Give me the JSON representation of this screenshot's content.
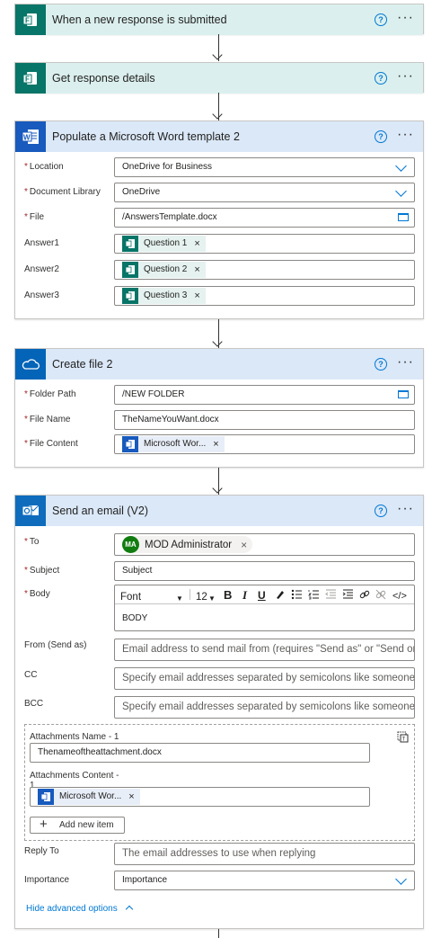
{
  "steps": {
    "trigger": {
      "title": "When a new response is submitted",
      "icon": "forms-icon"
    },
    "details": {
      "title": "Get response details",
      "icon": "forms-icon"
    },
    "word": {
      "title": "Populate a Microsoft Word template 2",
      "icon": "word-icon",
      "location_label": "Location",
      "location_value": "OneDrive for Business",
      "library_label": "Document Library",
      "library_value": "OneDrive",
      "file_label": "File",
      "file_value": "/AnswersTemplate.docx",
      "answer1_label": "Answer1",
      "answer2_label": "Answer2",
      "answer3_label": "Answer3",
      "answer1_token": "Question 1",
      "answer2_token": "Question 2",
      "answer3_token": "Question 3"
    },
    "create": {
      "title": "Create file 2",
      "icon": "onedrive-icon",
      "folder_label": "Folder Path",
      "folder_value": "/NEW FOLDER",
      "name_label": "File Name",
      "name_value": "TheNameYouWant.docx",
      "content_label": "File Content",
      "content_token": "Microsoft Wor..."
    },
    "email": {
      "title": "Send an email (V2)",
      "icon": "outlook-icon",
      "to_label": "To",
      "to_initials": "MA",
      "to_value": "MOD Administrator",
      "subject_label": "Subject",
      "subject_value": "Subject",
      "body_label": "Body",
      "font_label": "Font",
      "font_size": "12",
      "body_value": "BODY",
      "from_label": "From (Send as)",
      "from_placeholder": "Email address to send mail from (requires \"Send as\" or \"Send on beha",
      "cc_label": "CC",
      "cc_placeholder": "Specify email addresses separated by semicolons like someone@con",
      "bcc_label": "BCC",
      "bcc_placeholder": "Specify email addresses separated by semicolons like someone@con",
      "att_name_label": "Attachments Name - 1",
      "att_name_value": "Thenameoftheattachment.docx",
      "att_content_label": "Attachments Content -",
      "att_content_label_2": "1",
      "att_content_token": "Microsoft Wor...",
      "add_item_label": "Add new item",
      "reply_label": "Reply To",
      "reply_placeholder": "The email addresses to use when replying",
      "importance_label": "Importance",
      "importance_value": "Importance",
      "hide_advanced": "Hide advanced options"
    }
  },
  "common": {
    "help": "?",
    "more": "···",
    "required": "*",
    "close": "×",
    "plus": "+"
  },
  "colors": {
    "accent": "#0078d4",
    "forms": "#077568",
    "word": "#185abd",
    "onedrive": "#0364b8",
    "outlook": "#0f6cbd",
    "avatar": "#107c10"
  }
}
